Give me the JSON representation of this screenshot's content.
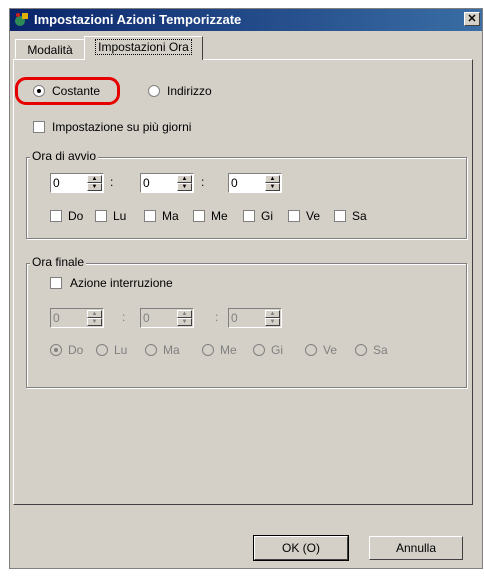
{
  "window": {
    "title": "Impostazioni Azioni Temporizzate"
  },
  "tabs": [
    {
      "label": "Modalità"
    },
    {
      "label": "Impostazioni Ora"
    }
  ],
  "mode": {
    "costante": "Costante",
    "indirizzo": "Indirizzo",
    "selected": "Costante"
  },
  "multi_day": {
    "label": "Impostazione su più giorni",
    "checked": false
  },
  "start": {
    "title": "Ora di avvio",
    "hours": "0",
    "minutes": "0",
    "seconds": "0",
    "days": [
      "Do",
      "Lu",
      "Ma",
      "Me",
      "Gi",
      "Ve",
      "Sa"
    ]
  },
  "end": {
    "title": "Ora finale",
    "interrupt_label": "Azione interruzione",
    "hours": "0",
    "minutes": "0",
    "seconds": "0",
    "days": [
      "Do",
      "Lu",
      "Ma",
      "Me",
      "Gi",
      "Ve",
      "Sa"
    ],
    "selected_day": "Do"
  },
  "buttons": {
    "ok": "OK (O)",
    "cancel": "Annulla"
  },
  "colors": {
    "highlight": "#e60000",
    "titlebar": "#0a246a",
    "face": "#d4d0c8"
  }
}
